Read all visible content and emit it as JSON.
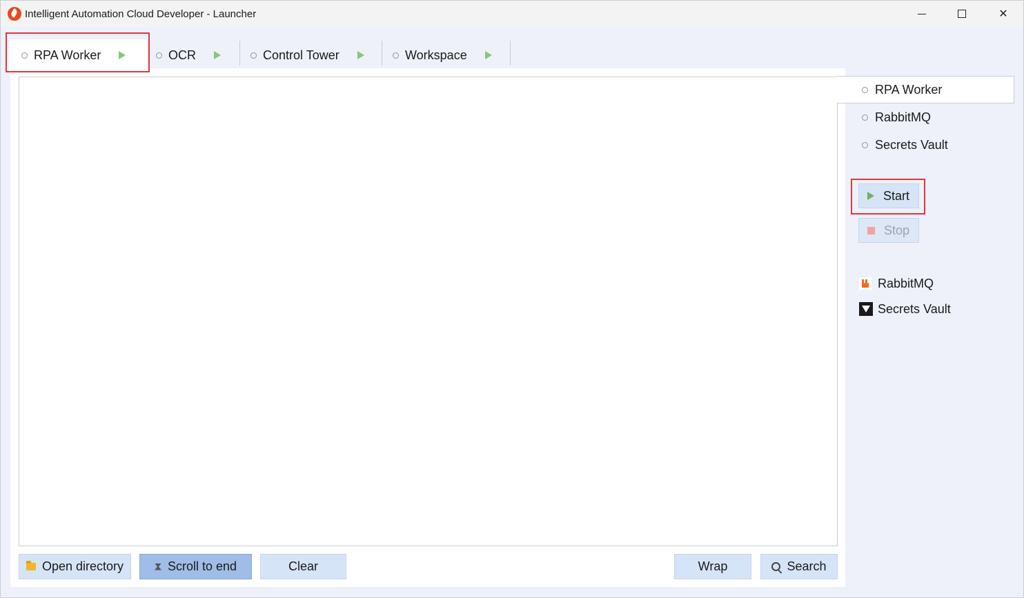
{
  "window": {
    "title": "Intelligent Automation Cloud Developer - Launcher",
    "close_glyph": "✕"
  },
  "tabs": [
    {
      "label": "RPA Worker",
      "active": true
    },
    {
      "label": "OCR",
      "active": false
    },
    {
      "label": "Control Tower",
      "active": false
    },
    {
      "label": "Workspace",
      "active": false
    }
  ],
  "toolbar": {
    "open_directory": "Open directory",
    "scroll_to_end": "Scroll to end",
    "clear": "Clear",
    "wrap": "Wrap",
    "search": "Search"
  },
  "side": {
    "services": [
      {
        "label": "RPA Worker",
        "selected": true
      },
      {
        "label": "RabbitMQ",
        "selected": false
      },
      {
        "label": "Secrets Vault",
        "selected": false
      }
    ],
    "start_label": "Start",
    "stop_label": "Stop",
    "links": [
      {
        "label": "RabbitMQ",
        "icon": "rabbitmq-icon"
      },
      {
        "label": "Secrets Vault",
        "icon": "vault-icon"
      }
    ]
  },
  "colors": {
    "accent_button": "#d6e4f7",
    "highlight_border": "#e0363b",
    "play_green": "#8bc47c",
    "stop_red": "#f2a2a4"
  }
}
